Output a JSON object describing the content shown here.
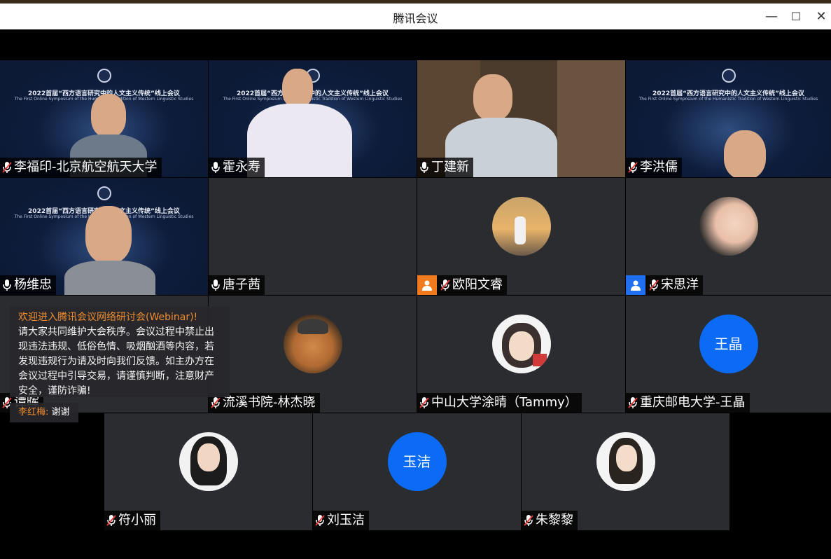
{
  "window": {
    "title": "腾讯会议",
    "minimize_symbol": "—",
    "maximize_symbol": "☐",
    "close_symbol": "✕"
  },
  "banner": {
    "title_cn": "2022首届“西方语言研究中的人文主义传统”线上会议",
    "title_en": "The First Online Symposium of the Humanistic Tradition of Western Linguistic Studies"
  },
  "participants": [
    {
      "name": "李福印-北京航空航天大学",
      "mic": "muted",
      "kind": "video-banner"
    },
    {
      "name": "霍永寿",
      "mic": "on",
      "kind": "video-banner"
    },
    {
      "name": "丁建新",
      "mic": "on",
      "kind": "video-office"
    },
    {
      "name": "李洪儒",
      "mic": "muted",
      "kind": "video-banner"
    },
    {
      "name": "杨维忠",
      "mic": "on",
      "kind": "video-banner"
    },
    {
      "name": "唐子茜",
      "mic": "on",
      "kind": "empty"
    },
    {
      "name": "欧阳文睿",
      "mic": "muted",
      "kind": "photo",
      "badge_color": "#f07a1c"
    },
    {
      "name": "宋思洋",
      "mic": "muted",
      "kind": "photo",
      "badge_color": "#1f6ff0"
    },
    {
      "name": "谭晖",
      "mic": "muted",
      "kind": "empty"
    },
    {
      "name": "流溪书院-林杰晓",
      "mic": "muted",
      "kind": "photo"
    },
    {
      "name": "中山大学涂晴（Tammy）",
      "mic": "muted",
      "kind": "photo"
    },
    {
      "name": "重庆邮电大学-王晶",
      "mic": "muted",
      "kind": "letter",
      "avatar_text": "王晶"
    },
    {
      "name": "符小丽",
      "mic": "muted",
      "kind": "photo"
    },
    {
      "name": "刘玉洁",
      "mic": "muted",
      "kind": "letter",
      "avatar_text": "玉洁"
    },
    {
      "name": "朱黎黎",
      "mic": "muted",
      "kind": "photo"
    }
  ],
  "notice": {
    "headline": "欢迎进入腾讯会议网络研讨会(Webinar)!",
    "body": "请大家共同维护大会秩序。会议过程中禁止出现违法违规、低俗色情、吸烟酗酒等内容，若发现违规行为请及时向我们反馈。如主办方在会议过程中引导交易，请谨慎判断，注意财产安全，谨防诈骗!"
  },
  "chat": {
    "sender": "李红梅:",
    "message": "谢谢"
  },
  "colors": {
    "accent_blue": "#0b6bf5",
    "notice_orange": "#f08c2e",
    "tile_bg": "#2b2c30",
    "muted_red": "#e23b3b"
  }
}
